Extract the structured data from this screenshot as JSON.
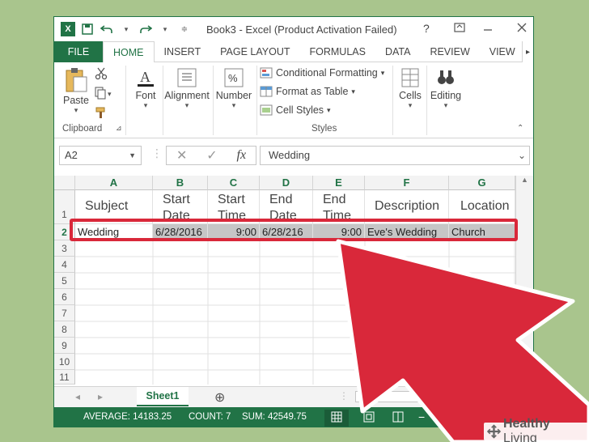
{
  "window": {
    "title": "Book3 - Excel (Product Activation Failed)",
    "help": "?",
    "accent": "#217346"
  },
  "tabs": [
    "FILE",
    "HOME",
    "INSERT",
    "PAGE LAYOUT",
    "FORMULAS",
    "DATA",
    "REVIEW",
    "VIEW"
  ],
  "ribbon": {
    "paste": "Paste",
    "clipboard": "Clipboard",
    "font": "Font",
    "alignment": "Alignment",
    "number": "Number",
    "conditional_formatting": "Conditional Formatting",
    "format_as_table": "Format as Table",
    "cell_styles": "Cell Styles",
    "styles": "Styles",
    "cells": "Cells",
    "editing": "Editing"
  },
  "formula_bar": {
    "name_box": "A2",
    "fx": "fx",
    "value": "Wedding"
  },
  "columns": [
    "A",
    "B",
    "C",
    "D",
    "E",
    "F",
    "G"
  ],
  "row_numbers": [
    "1",
    "2",
    "3",
    "4",
    "5",
    "6",
    "7",
    "8",
    "9",
    "10",
    "11"
  ],
  "header_row": [
    "Subject",
    "Start Date",
    "Start Time",
    "End Date",
    "End Time",
    "Description",
    "Location"
  ],
  "data_row": [
    "Wedding",
    "6/28/2016",
    "9:00",
    "6/28/216",
    "9:00",
    "Eve's Wedding",
    "Church"
  ],
  "sheet": {
    "tab": "Sheet1",
    "add": "⊕"
  },
  "status": {
    "average": "AVERAGE: 14183.25",
    "count": "COUNT: 7",
    "sum": "SUM: 42549.75"
  },
  "watermark": {
    "brand_a": "Healthy",
    "brand_b": " Living"
  },
  "colors": {
    "highlight": "#d9283a",
    "background": "#a9c58d"
  }
}
